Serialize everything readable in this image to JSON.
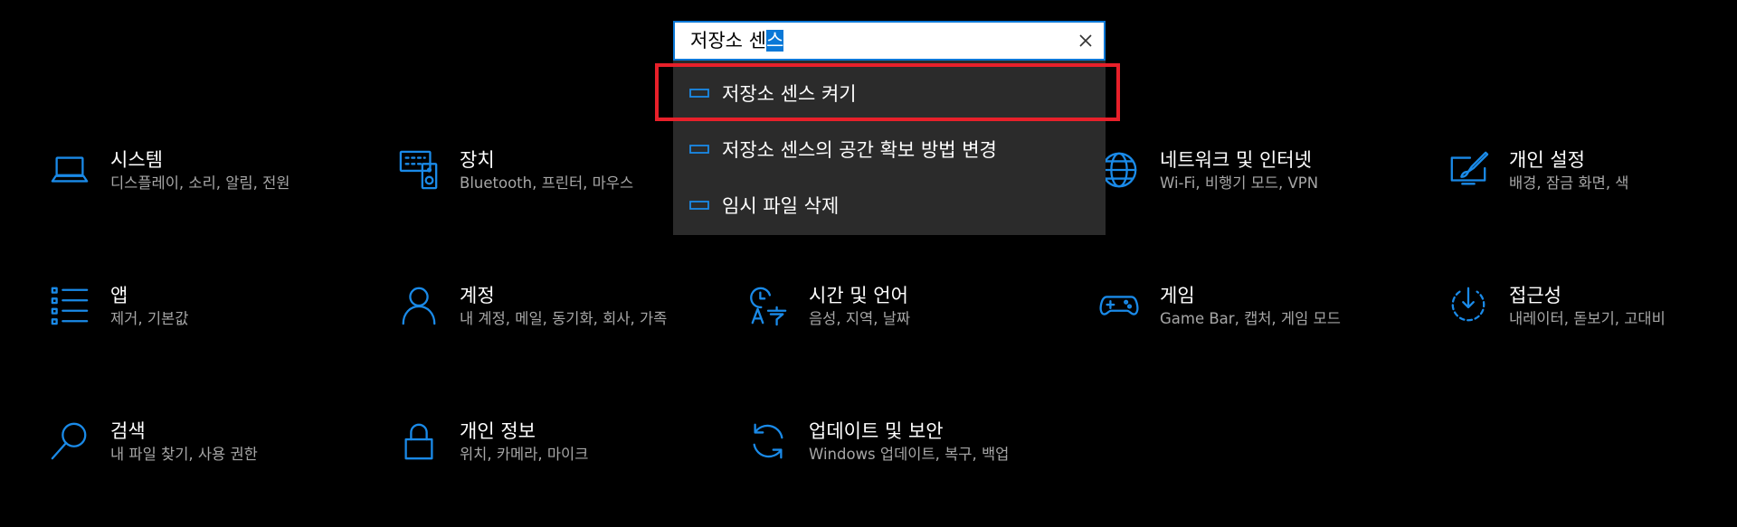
{
  "search": {
    "value_prefix": "저장소 센",
    "value_selected": "스",
    "clear_icon": "close-icon"
  },
  "suggestions": [
    {
      "label": "저장소 센스 켜기",
      "icon": "storage-drive-icon"
    },
    {
      "label": "저장소 센스의 공간 확보 방법 변경",
      "icon": "storage-drive-icon"
    },
    {
      "label": "임시 파일 삭제",
      "icon": "storage-drive-icon"
    }
  ],
  "categories": [
    {
      "title": "시스템",
      "desc": "디스플레이, 소리, 알림, 전원",
      "icon": "laptop-icon"
    },
    {
      "title": "장치",
      "desc": "Bluetooth, 프린터, 마우스",
      "icon": "keyboard-speaker-icon"
    },
    {
      "title": "네트워크 및 인터넷",
      "desc": "Wi-Fi, 비행기 모드, VPN",
      "icon": "globe-icon"
    },
    {
      "title": "개인 설정",
      "desc": "배경, 잠금 화면, 색",
      "icon": "paint-icon"
    },
    {
      "title": "앱",
      "desc": "제거, 기본값",
      "icon": "apps-list-icon"
    },
    {
      "title": "계정",
      "desc": "내 계정, 메일, 동기화, 회사, 가족",
      "icon": "person-icon"
    },
    {
      "title": "시간 및 언어",
      "desc": "음성, 지역, 날짜",
      "icon": "time-language-icon"
    },
    {
      "title": "게임",
      "desc": "Game Bar, 캡처, 게임 모드",
      "icon": "gamepad-icon"
    },
    {
      "title": "접근성",
      "desc": "내레이터, 돋보기, 고대비",
      "icon": "ease-of-access-icon"
    },
    {
      "title": "검색",
      "desc": "내 파일 찾기, 사용 권한",
      "icon": "search-icon"
    },
    {
      "title": "개인 정보",
      "desc": "위치, 카메라, 마이크",
      "icon": "lock-icon"
    },
    {
      "title": "업데이트 및 보안",
      "desc": "Windows 업데이트, 복구, 백업",
      "icon": "sync-icon"
    }
  ],
  "colors": {
    "accent": "#1a8ae8",
    "highlight": "#e8202a",
    "dropdown_bg": "#2b2b2b",
    "description": "#a6a6a6"
  }
}
